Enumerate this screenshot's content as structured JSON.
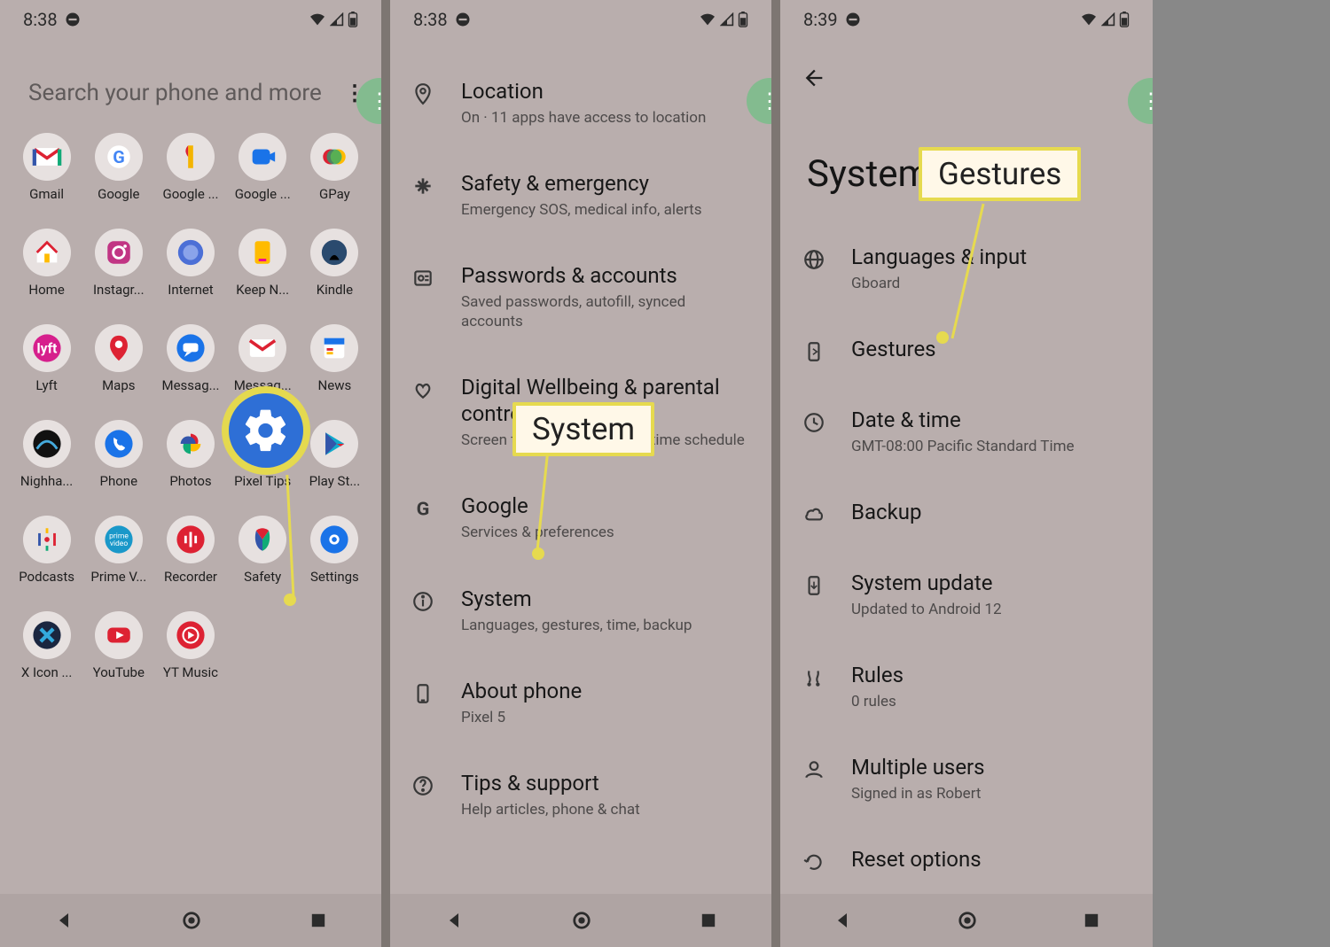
{
  "status": {
    "time1": "8:38",
    "time2": "8:38",
    "time3": "8:39"
  },
  "screen1": {
    "search_placeholder": "Search your phone and more",
    "apps": [
      {
        "label": "Gmail",
        "icon": "gmail"
      },
      {
        "label": "Google",
        "icon": "google"
      },
      {
        "label": "Google ...",
        "icon": "googleone"
      },
      {
        "label": "Google ...",
        "icon": "googleduo"
      },
      {
        "label": "GPay",
        "icon": "gpay"
      },
      {
        "label": "Home",
        "icon": "home"
      },
      {
        "label": "Instagr...",
        "icon": "instagram"
      },
      {
        "label": "Internet",
        "icon": "internet"
      },
      {
        "label": "Keep N...",
        "icon": "keep"
      },
      {
        "label": "Kindle",
        "icon": "kindle"
      },
      {
        "label": "Lyft",
        "icon": "lyft"
      },
      {
        "label": "Maps",
        "icon": "maps"
      },
      {
        "label": "Messag...",
        "icon": "messages"
      },
      {
        "label": "Messag...",
        "icon": "gmail2"
      },
      {
        "label": "News",
        "icon": "news"
      },
      {
        "label": "Nighha...",
        "icon": "netgear"
      },
      {
        "label": "Phone",
        "icon": "phone"
      },
      {
        "label": "Photos",
        "icon": "photos"
      },
      {
        "label": "Pixel Tips",
        "icon": "tips"
      },
      {
        "label": "Play St...",
        "icon": "play"
      },
      {
        "label": "Podcasts",
        "icon": "podcasts"
      },
      {
        "label": "Prime V...",
        "icon": "prime"
      },
      {
        "label": "Recorder",
        "icon": "recorder"
      },
      {
        "label": "Safety",
        "icon": "safety"
      },
      {
        "label": "Settings",
        "icon": "settings"
      },
      {
        "label": "X Icon ...",
        "icon": "xicon"
      },
      {
        "label": "YouTube",
        "icon": "youtube"
      },
      {
        "label": "YT Music",
        "icon": "ytmusic"
      }
    ],
    "callout_label": "Settings"
  },
  "screen2": {
    "items": [
      {
        "title": "Location",
        "sub": "On · 11 apps have access to location",
        "icon": "location"
      },
      {
        "title": "Safety & emergency",
        "sub": "Emergency SOS, medical info, alerts",
        "icon": "medical"
      },
      {
        "title": "Passwords & accounts",
        "sub": "Saved passwords, autofill, synced accounts",
        "icon": "account"
      },
      {
        "title": "Digital Wellbeing & parental controls",
        "sub": "Screen time, app timers, bedtime schedule",
        "icon": "wellbeing"
      },
      {
        "title": "Google",
        "sub": "Services & preferences",
        "icon": "google-g"
      },
      {
        "title": "System",
        "sub": "Languages, gestures, time, backup",
        "icon": "info"
      },
      {
        "title": "About phone",
        "sub": "Pixel 5",
        "icon": "phone-device"
      },
      {
        "title": "Tips & support",
        "sub": "Help articles, phone & chat",
        "icon": "help"
      }
    ],
    "callout_label": "System"
  },
  "screen3": {
    "page_title": "System",
    "items": [
      {
        "title": "Languages & input",
        "sub": "Gboard",
        "icon": "globe"
      },
      {
        "title": "Gestures",
        "sub": "",
        "icon": "gesture"
      },
      {
        "title": "Date & time",
        "sub": "GMT-08:00 Pacific Standard Time",
        "icon": "clock"
      },
      {
        "title": "Backup",
        "sub": "",
        "icon": "cloud"
      },
      {
        "title": "System update",
        "sub": "Updated to Android 12",
        "icon": "update"
      },
      {
        "title": "Rules",
        "sub": "0 rules",
        "icon": "rules"
      },
      {
        "title": "Multiple users",
        "sub": "Signed in as Robert",
        "icon": "person"
      },
      {
        "title": "Reset options",
        "sub": "",
        "icon": "reset"
      }
    ],
    "callout_label": "Gestures"
  }
}
